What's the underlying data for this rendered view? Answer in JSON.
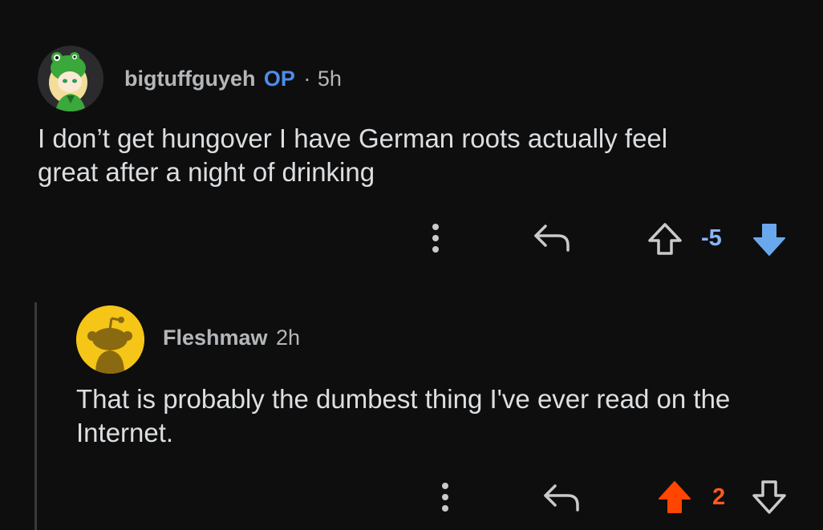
{
  "comment": {
    "username": "bigtuffguyeh",
    "op_badge": "OP",
    "separator": "·",
    "time": "5h",
    "body_line1": "I don’t get hungover I have German roots actually feel",
    "body_line2": "great after a night of drinking",
    "score": "-5",
    "vote_state": "downvoted",
    "icons": [
      "more-vertical-icon",
      "reply-icon",
      "upvote-icon",
      "downvote-icon"
    ]
  },
  "reply": {
    "username": "Fleshmaw",
    "time": "2h",
    "body_line1": "That is probably the dumbest thing I've ever read on the",
    "body_line2": "Internet.",
    "score": "2",
    "vote_state": "upvoted",
    "icons": [
      "more-vertical-icon",
      "reply-icon",
      "upvote-icon",
      "downvote-icon"
    ]
  },
  "colors": {
    "background": "#0e0e0f",
    "op_blue": "#4c8de8",
    "downvote_blue": "#6aa8ee",
    "upvote_orange": "#ff4500",
    "avatar_yellow": "#f5c518"
  }
}
